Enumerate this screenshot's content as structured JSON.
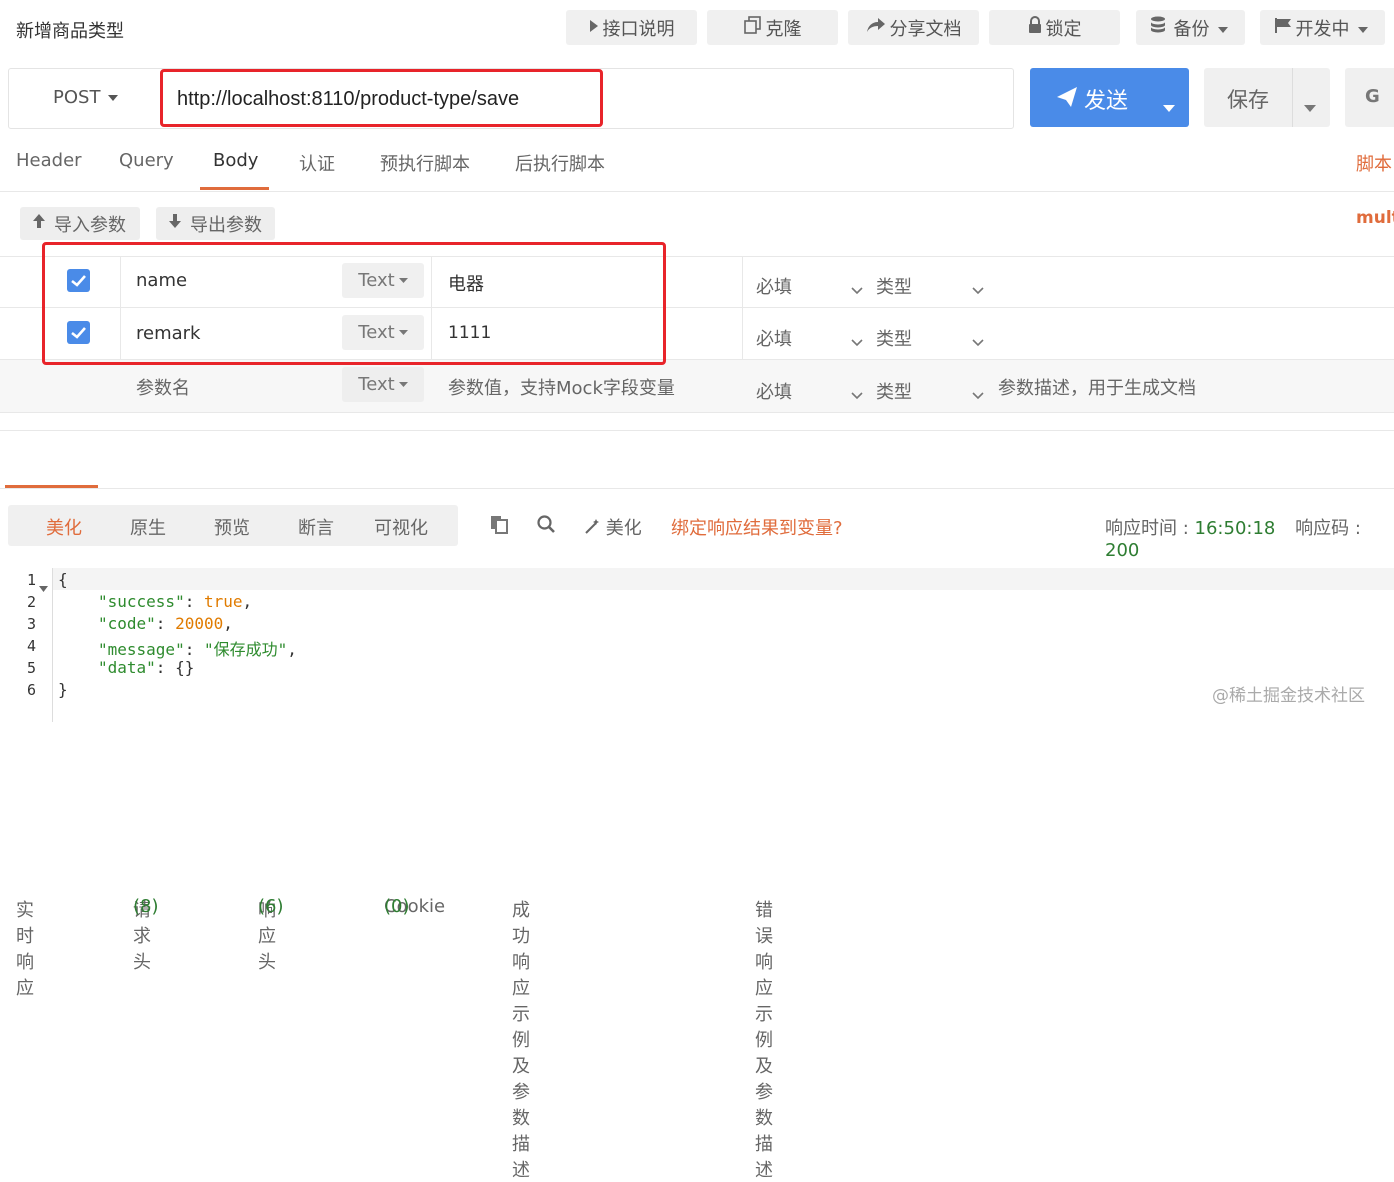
{
  "page_title": "新增商品类型",
  "toolbar": {
    "doc_label": "接口说明",
    "clone_label": "克隆",
    "share_label": "分享文档",
    "lock_label": "锁定",
    "backup_label": "备份",
    "status_label": "开发中"
  },
  "request": {
    "method": "POST",
    "url": "http://localhost:8110/product-type/save",
    "send_label": "发送",
    "save_label": "保存",
    "extra_label": "G"
  },
  "req_tabs": [
    "Header",
    "Query",
    "Body",
    "认证",
    "预执行脚本",
    "后执行脚本"
  ],
  "req_tab_active": "Body",
  "script_link": "脚本",
  "body_mode": "mult",
  "params_toolbar": {
    "import_label": "导入参数",
    "export_label": "导出参数"
  },
  "params": [
    {
      "checked": true,
      "name": "name",
      "type": "Text",
      "value": "电器",
      "required": "必填",
      "datatype": "类型"
    },
    {
      "checked": true,
      "name": "remark",
      "type": "Text",
      "value": "1111",
      "required": "必填",
      "datatype": "类型"
    }
  ],
  "param_placeholder": {
    "name": "参数名",
    "type": "Text",
    "value": "参数值，支持Mock字段变量",
    "required": "必填",
    "datatype": "类型",
    "desc": "参数描述，用于生成文档"
  },
  "resp_tabs": [
    {
      "label": "实时响应",
      "count": ""
    },
    {
      "label": "请求头",
      "count": "(8)"
    },
    {
      "label": "响应头",
      "count": "(6)"
    },
    {
      "label": "Cookie",
      "count": "(0)"
    },
    {
      "label": "成功响应示例及参数描述",
      "count": ""
    },
    {
      "label": "错误响应示例及参数描述",
      "count": ""
    }
  ],
  "view_modes": [
    "美化",
    "原生",
    "预览",
    "断言",
    "可视化"
  ],
  "view_mode_active": "美化",
  "resp_tools": {
    "beautify_label": "美化",
    "bind_label": "绑定响应结果到变量?"
  },
  "resp_meta": {
    "time_label": "响应时间 :",
    "time_value": "16:50:18",
    "code_label": "响应码 :",
    "code_value": "200"
  },
  "response_lines": [
    "1",
    "2",
    "3",
    "4",
    "5",
    "6"
  ],
  "response_json": {
    "open": "{",
    "k1": "\"success\"",
    "v1": "true",
    "k2": "\"code\"",
    "v2": "20000",
    "k3": "\"message\"",
    "v3": "\"保存成功\"",
    "k4": "\"data\"",
    "v4": "{}",
    "close": "}"
  },
  "watermark": "@稀土掘金技术社区",
  "colors": {
    "accent": "#4a8be8",
    "active_tab": "#e06c3c",
    "highlight": "#e8242a",
    "json_key": "#2e8b2e",
    "json_value": "#e07b00",
    "json_string": "#2e8b2e",
    "green_value": "#2e7d32"
  }
}
